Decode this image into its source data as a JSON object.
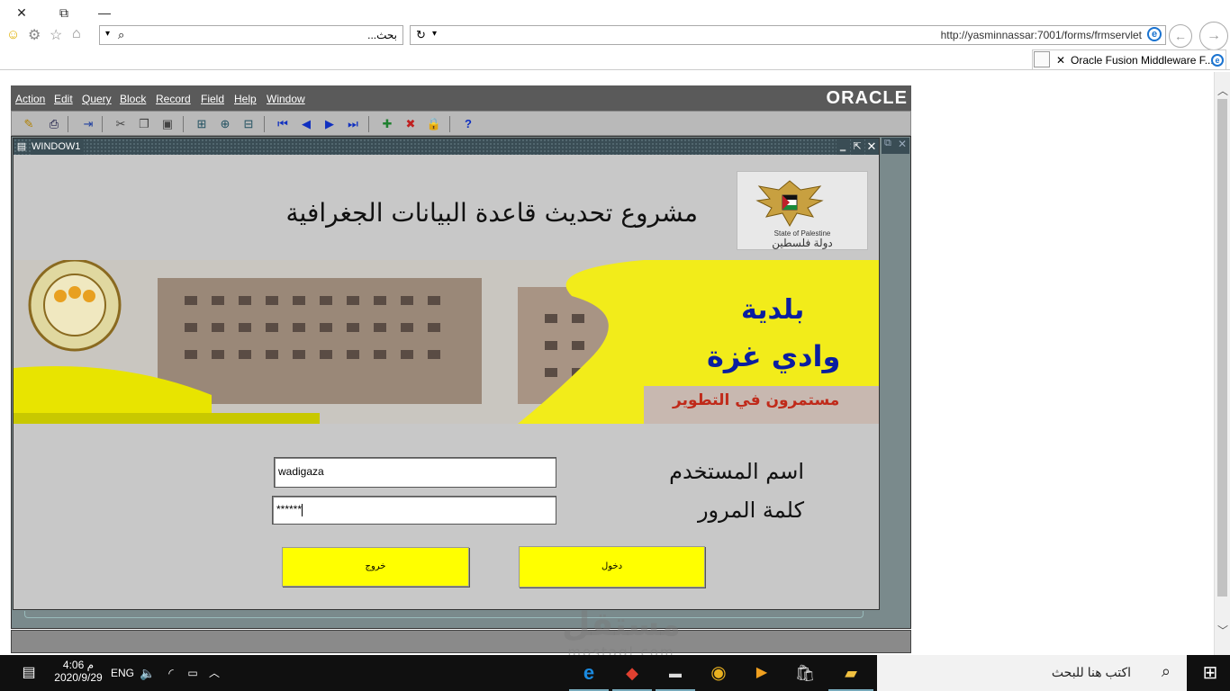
{
  "browser": {
    "window_controls": {
      "close": "✕",
      "restore": "⧉",
      "minimize": "—"
    },
    "search_box_text": "بحث...",
    "address_url": "http://yasminnassar:7001/forms/frmservlet",
    "tab_title": "Oracle Fusion Middleware F...",
    "toolbar_icons": [
      "smiley-icon",
      "gear-icon",
      "star-icon",
      "home-icon"
    ]
  },
  "app": {
    "menu": [
      "Action",
      "Edit",
      "Query",
      "Block",
      "Record",
      "Field",
      "Help",
      "Window"
    ],
    "logo": "ORACLE",
    "window_title": "WINDOW1",
    "heading": "مشروع تحديث قاعدة البيانات الجغرافية",
    "seal_caption_en": "State of Palestine",
    "seal_caption_ar": "دولة فلسطين",
    "banner": {
      "line1": "بلدية",
      "line2": "وادي غزة",
      "line3": "مستمرون في التطوير"
    },
    "form": {
      "username_label": "اسم المستخدم",
      "username_value": "wadigaza",
      "password_label": "كلمة المرور",
      "password_value": "******",
      "login_button": "دخول",
      "exit_button": "خروج"
    }
  },
  "watermark": {
    "top": "مستقل",
    "bottom": "mostaql.com"
  },
  "taskbar": {
    "time": "4:06 م",
    "date": "2020/9/29",
    "language": "ENG",
    "search_placeholder": "اكتب هنا للبحث"
  }
}
